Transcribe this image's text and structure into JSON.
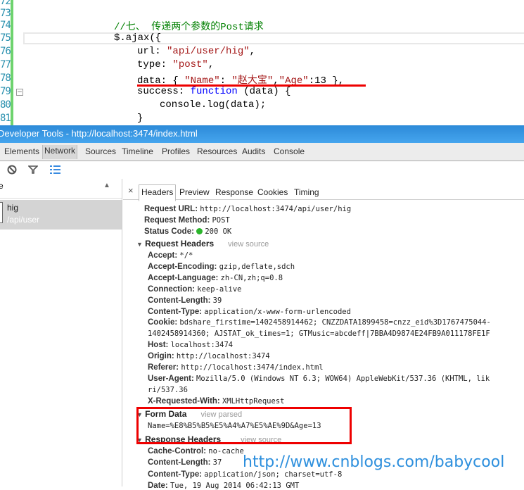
{
  "editor": {
    "line_numbers": [
      "72",
      "73",
      "74",
      "75",
      "76",
      "77",
      "78",
      "79",
      "80",
      "81"
    ],
    "comment": "//七、 传递两个参数的Post请求",
    "ajax_open": "$.ajax({",
    "url_key": "url: ",
    "url_val": "\"api/user/hig\"",
    "url_end": ",",
    "type_key": "type: ",
    "type_val": "\"post\"",
    "type_end": ",",
    "data_key": "data: { ",
    "data_name_key": "\"Name\"",
    "data_colon": ": ",
    "data_name_val": "\"赵大宝\"",
    "data_comma": ",",
    "data_age_key": "\"Age\"",
    "data_age_val": ":13 },",
    "success_key": "success: ",
    "success_fn": "function",
    "success_rest": " (data) {",
    "console_line": "console.log(data);",
    "close_brace": "}"
  },
  "window": {
    "title": "Developer Tools - http://localhost:3474/index.html"
  },
  "tabs": [
    "Elements",
    "Network",
    "Sources",
    "Timeline",
    "Profiles",
    "Resources",
    "Audits",
    "Console"
  ],
  "network": {
    "column_header": "e",
    "request": {
      "name": "hig",
      "path": "/api/user"
    }
  },
  "detail_tabs": [
    "Headers",
    "Preview",
    "Response",
    "Cookies",
    "Timing"
  ],
  "general": [
    {
      "k": "Request URL:",
      "v": "http://localhost:3474/api/user/hig"
    },
    {
      "k": "Request Method:",
      "v": "POST"
    }
  ],
  "status": {
    "k": "Status Code:",
    "v": "200 OK",
    "color": "#2cb52c"
  },
  "request_headers": {
    "title": "Request Headers",
    "link": "view source",
    "items": [
      {
        "k": "Accept:",
        "v": "*/*"
      },
      {
        "k": "Accept-Encoding:",
        "v": "gzip,deflate,sdch"
      },
      {
        "k": "Accept-Language:",
        "v": "zh-CN,zh;q=0.8"
      },
      {
        "k": "Connection:",
        "v": "keep-alive"
      },
      {
        "k": "Content-Length:",
        "v": "39"
      },
      {
        "k": "Content-Type:",
        "v": "application/x-www-form-urlencoded"
      },
      {
        "k": "Cookie:",
        "v": "bdshare_firstime=1402458914462; CNZZDATA1899458=cnzz_eid%3D1767475044-"
      },
      {
        "k": "",
        "v": "1402458914360; AJSTAT_ok_times=1; GTMusic=abcdeff|7BBA4D9874E24FB9A011178FE1F"
      },
      {
        "k": "Host:",
        "v": "localhost:3474"
      },
      {
        "k": "Origin:",
        "v": "http://localhost:3474"
      },
      {
        "k": "Referer:",
        "v": "http://localhost:3474/index.html"
      },
      {
        "k": "User-Agent:",
        "v": "Mozilla/5.0 (Windows NT 6.3; WOW64) AppleWebKit/537.36 (KHTML, lik"
      },
      {
        "k": "",
        "v": "ri/537.36"
      },
      {
        "k": "X-Requested-With:",
        "v": "XMLHttpRequest"
      }
    ]
  },
  "form_data": {
    "title": "Form Data",
    "link": "view parsed",
    "value": "Name=%E8%B5%B5%E5%A4%A7%E5%AE%9D&Age=13"
  },
  "response_headers": {
    "title": "Response Headers",
    "link": "view source",
    "items": [
      {
        "k": "Cache-Control:",
        "v": "no-cache"
      },
      {
        "k": "Content-Length:",
        "v": "37"
      },
      {
        "k": "Content-Type:",
        "v": "application/json; charset=utf-8"
      },
      {
        "k": "Date:",
        "v": "Tue, 19 Aug 2014 06:42:13 GMT"
      }
    ]
  },
  "watermark": "http://www.cnblogs.com/babycool"
}
